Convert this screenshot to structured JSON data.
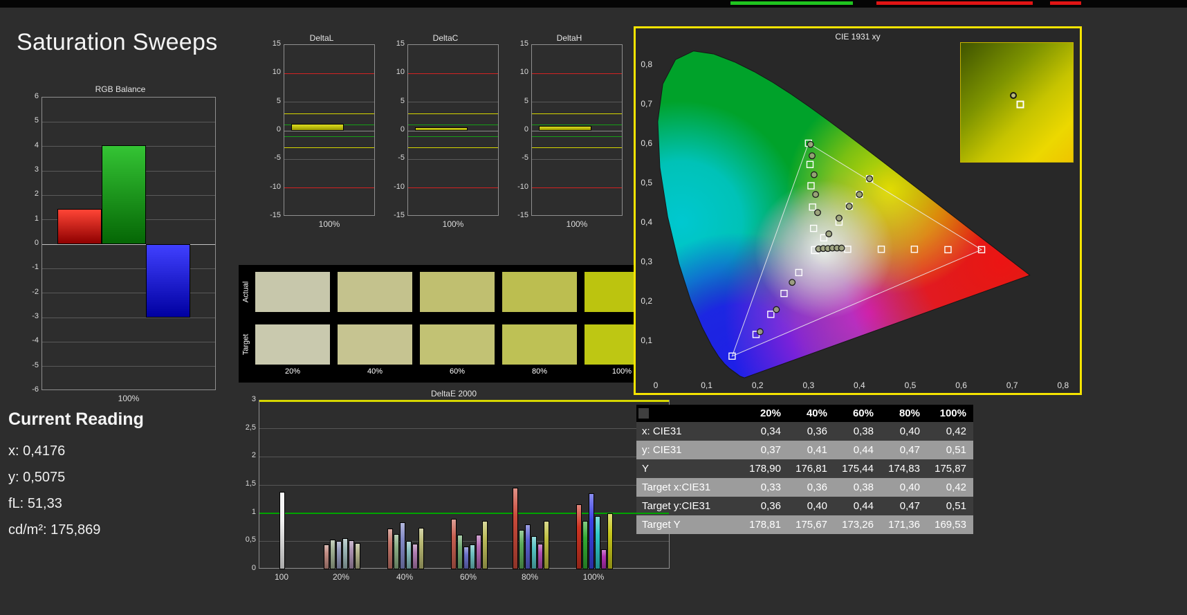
{
  "page": {
    "title": "Saturation Sweeps",
    "background": "#2d2d2d"
  },
  "top_bar": {
    "segments": [
      {
        "name": "green-tab-indicator",
        "color": "#1fc41f"
      },
      {
        "name": "red-tab-indicator-1",
        "color": "#e01414"
      },
      {
        "name": "red-tab-indicator-2",
        "color": "#e01414"
      }
    ]
  },
  "current_reading": {
    "heading": "Current Reading",
    "lines": [
      {
        "label": "x:",
        "value": "0,4176"
      },
      {
        "label": "y:",
        "value": "0,5075"
      },
      {
        "label": "fL:",
        "value": "51,33"
      },
      {
        "label": "cd/m²:",
        "value": "175,869"
      }
    ]
  },
  "chart_data": [
    {
      "id": "rgb_balance",
      "type": "bar",
      "title": "RGB Balance",
      "categories": [
        "Red",
        "Green",
        "Blue"
      ],
      "values": [
        1.45,
        4.05,
        -3.0
      ],
      "bar_colors": [
        [
          "#ff4536",
          "#8e0000"
        ],
        [
          "#34c434",
          "#056605"
        ],
        [
          "#4040ff",
          "#0000a0"
        ]
      ],
      "ylim": [
        -6,
        6
      ],
      "xlabel": "100%"
    },
    {
      "id": "delta_l",
      "type": "bar",
      "title": "DeltaL",
      "categories": [
        "100%"
      ],
      "values": [
        1.2
      ],
      "ylim": [
        -15,
        15
      ],
      "yticks": [
        15,
        10,
        5,
        0,
        -5,
        -10,
        -15
      ],
      "ref_lines": [
        {
          "y": 10,
          "color": "#d42222"
        },
        {
          "y": -10,
          "color": "#d42222"
        },
        {
          "y": 3,
          "color": "#d8d800"
        },
        {
          "y": -3,
          "color": "#d8d800"
        },
        {
          "y": 1,
          "color": "#16a016"
        },
        {
          "y": -1,
          "color": "#16a016"
        }
      ],
      "bar_color": [
        "#dede20",
        "#9a9a00"
      ],
      "xlabel": "100%"
    },
    {
      "id": "delta_c",
      "type": "bar",
      "title": "DeltaC",
      "categories": [
        "100%"
      ],
      "values": [
        0.6
      ],
      "ylim": [
        -15,
        15
      ],
      "yticks": [
        15,
        10,
        5,
        0,
        -5,
        -10,
        -15
      ],
      "ref_lines": [
        {
          "y": 10,
          "color": "#d42222"
        },
        {
          "y": -10,
          "color": "#d42222"
        },
        {
          "y": 3,
          "color": "#d8d800"
        },
        {
          "y": -3,
          "color": "#d8d800"
        },
        {
          "y": 1,
          "color": "#16a016"
        },
        {
          "y": -1,
          "color": "#16a016"
        }
      ],
      "bar_color": [
        "#dede20",
        "#9a9a00"
      ],
      "xlabel": "100%"
    },
    {
      "id": "delta_h",
      "type": "bar",
      "title": "DeltaH",
      "categories": [
        "100%"
      ],
      "values": [
        0.9
      ],
      "ylim": [
        -15,
        15
      ],
      "yticks": [
        15,
        10,
        5,
        0,
        -5,
        -10,
        -15
      ],
      "ref_lines": [
        {
          "y": 10,
          "color": "#d42222"
        },
        {
          "y": -10,
          "color": "#d42222"
        },
        {
          "y": 3,
          "color": "#d8d800"
        },
        {
          "y": -3,
          "color": "#d8d800"
        },
        {
          "y": 1,
          "color": "#16a016"
        },
        {
          "y": -1,
          "color": "#16a016"
        }
      ],
      "bar_color": [
        "#dede20",
        "#9a9a00"
      ],
      "xlabel": "100%"
    },
    {
      "id": "saturation_swatches",
      "type": "table",
      "row_labels": [
        "Actual",
        "Target"
      ],
      "col_labels": [
        "20%",
        "40%",
        "60%",
        "80%",
        "100%"
      ],
      "actual_colors": [
        "#c7c7ab",
        "#c4c28d",
        "#c0bf70",
        "#bcbe50",
        "#bcc40f"
      ],
      "target_colors": [
        "#c9c9ae",
        "#c6c491",
        "#c2c274",
        "#bec155",
        "#bec713"
      ]
    },
    {
      "id": "delta_e_2000",
      "type": "bar",
      "title": "DeltaE 2000",
      "ylim": [
        0,
        3
      ],
      "ytick_labels": [
        "0",
        "0,5",
        "1",
        "1,5",
        "2",
        "2,5",
        "3"
      ],
      "ref_lines": [
        {
          "y": 1,
          "color": "#00a400"
        },
        {
          "y": 3,
          "color": "#d6d600"
        }
      ],
      "groups": [
        {
          "label": "100",
          "colors": [
            "#f2f2f2"
          ],
          "values": [
            1.38
          ]
        },
        {
          "label": "20%",
          "colors": [
            "#c08b82",
            "#9fae93",
            "#9297b8",
            "#9cb6b6",
            "#a98fae",
            "#b3b38b"
          ],
          "values": [
            0.44,
            0.53,
            0.5,
            0.55,
            0.52,
            0.47
          ]
        },
        {
          "label": "40%",
          "colors": [
            "#c4766a",
            "#8bae84",
            "#8289c6",
            "#86bcbc",
            "#b07cb0",
            "#b8b872"
          ],
          "values": [
            0.72,
            0.63,
            0.84,
            0.5,
            0.46,
            0.74
          ]
        },
        {
          "label": "60%",
          "colors": [
            "#c65f50",
            "#73ac73",
            "#6a70c8",
            "#6ec0c0",
            "#b066b0",
            "#bcbc5a"
          ],
          "values": [
            0.9,
            0.62,
            0.41,
            0.44,
            0.61,
            0.86
          ]
        },
        {
          "label": "80%",
          "colors": [
            "#ca4a3a",
            "#5aaa5a",
            "#5a60d2",
            "#56c4c4",
            "#b04cb0",
            "#c0c042"
          ],
          "values": [
            1.45,
            0.7,
            0.8,
            0.59,
            0.45,
            0.86
          ]
        },
        {
          "label": "100%",
          "colors": [
            "#ce3422",
            "#32aa32",
            "#3c42e4",
            "#2ec8c8",
            "#b230b2",
            "#c6c61c"
          ],
          "values": [
            1.15,
            0.86,
            1.35,
            0.95,
            0.36,
            1.0
          ]
        }
      ]
    },
    {
      "id": "cie_1931",
      "type": "scatter",
      "title": "CIE 1931 xy",
      "xlim": [
        0,
        0.85
      ],
      "ylim": [
        0,
        0.85
      ],
      "xtick_labels": [
        "0",
        "0,1",
        "0,2",
        "0,3",
        "0,4",
        "0,5",
        "0,6",
        "0,7",
        "0,8"
      ],
      "ytick_labels": [
        "0,1",
        "0,2",
        "0,3",
        "0,4",
        "0,5",
        "0,6",
        "0,7",
        "0,8"
      ],
      "border_color": "#f6e400",
      "gamut_triangle": {
        "red": [
          0.64,
          0.33
        ],
        "green": [
          0.3,
          0.6
        ],
        "blue": [
          0.15,
          0.06
        ]
      },
      "white_point": [
        0.3127,
        0.329
      ],
      "target_points": [
        [
          0.377,
          0.331
        ],
        [
          0.443,
          0.331
        ],
        [
          0.508,
          0.331
        ],
        [
          0.574,
          0.33
        ],
        [
          0.64,
          0.33
        ],
        [
          0.31,
          0.384
        ],
        [
          0.308,
          0.438
        ],
        [
          0.305,
          0.492
        ],
        [
          0.303,
          0.546
        ],
        [
          0.3,
          0.6
        ],
        [
          0.281,
          0.272
        ],
        [
          0.252,
          0.219
        ],
        [
          0.226,
          0.166
        ],
        [
          0.197,
          0.115
        ],
        [
          0.15,
          0.06
        ],
        [
          0.33,
          0.36
        ],
        [
          0.36,
          0.4
        ],
        [
          0.38,
          0.44
        ],
        [
          0.4,
          0.47
        ],
        [
          0.42,
          0.51
        ]
      ],
      "measured_points": [
        [
          0.34,
          0.37
        ],
        [
          0.36,
          0.41
        ],
        [
          0.38,
          0.44
        ],
        [
          0.4,
          0.47
        ],
        [
          0.42,
          0.51
        ],
        [
          0.32,
          0.332
        ],
        [
          0.329,
          0.333
        ],
        [
          0.338,
          0.333
        ],
        [
          0.347,
          0.334
        ],
        [
          0.356,
          0.334
        ],
        [
          0.365,
          0.334
        ],
        [
          0.318,
          0.424
        ],
        [
          0.314,
          0.47
        ],
        [
          0.311,
          0.52
        ],
        [
          0.307,
          0.568
        ],
        [
          0.304,
          0.597
        ],
        [
          0.268,
          0.247
        ],
        [
          0.237,
          0.178
        ],
        [
          0.205,
          0.122
        ]
      ],
      "inset": {
        "circle": [
          0.47,
          0.44
        ],
        "square": [
          0.53,
          0.52
        ]
      }
    }
  ],
  "measurement_table": {
    "columns": [
      "20%",
      "40%",
      "60%",
      "80%",
      "100%"
    ],
    "rows": [
      {
        "label": "x: CIE31",
        "values": [
          "0,34",
          "0,36",
          "0,38",
          "0,40",
          "0,42"
        ]
      },
      {
        "label": "y: CIE31",
        "values": [
          "0,37",
          "0,41",
          "0,44",
          "0,47",
          "0,51"
        ]
      },
      {
        "label": "Y",
        "values": [
          "178,90",
          "176,81",
          "175,44",
          "174,83",
          "175,87"
        ]
      },
      {
        "label": "Target x:CIE31",
        "values": [
          "0,33",
          "0,36",
          "0,38",
          "0,40",
          "0,42"
        ]
      },
      {
        "label": "Target y:CIE31",
        "values": [
          "0,36",
          "0,40",
          "0,44",
          "0,47",
          "0,51"
        ]
      },
      {
        "label": "Target Y",
        "values": [
          "178,81",
          "175,67",
          "173,26",
          "171,36",
          "169,53"
        ]
      }
    ],
    "header_bg": "#000000",
    "row_bg_dark": "#3c3c3c",
    "row_bg_light": "#9c9c9c"
  }
}
